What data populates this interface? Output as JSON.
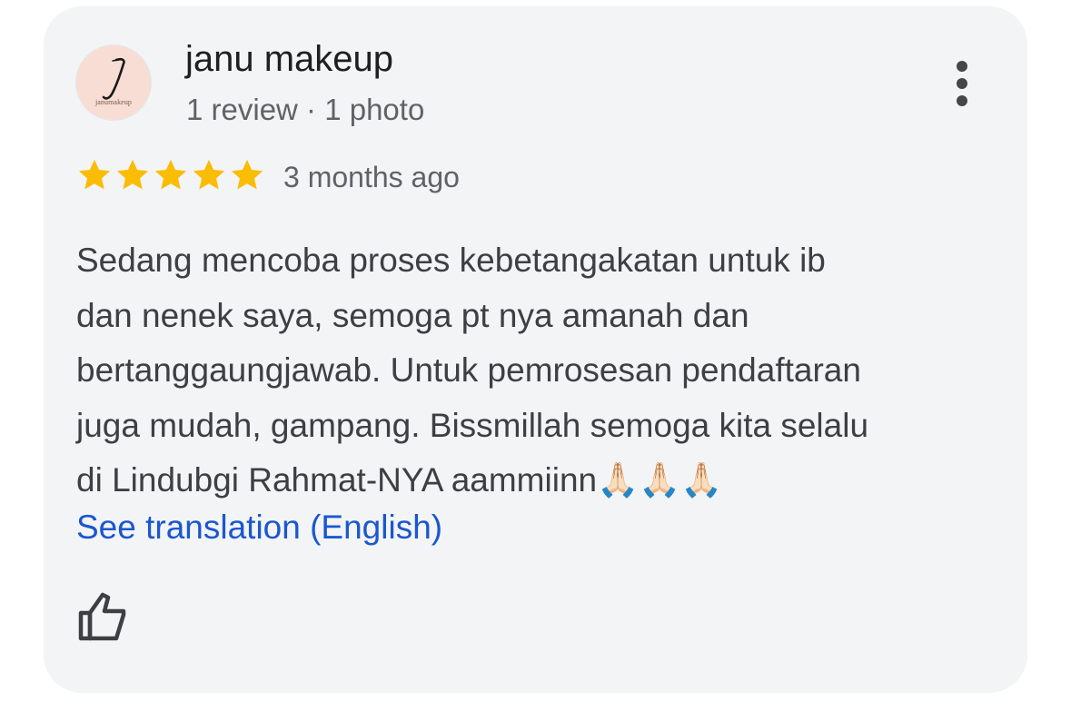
{
  "review": {
    "author": {
      "name": "janu makeup",
      "meta": "1 review · 1 photo",
      "avatar": {
        "monogram": "J",
        "wordmark": "janumakeup",
        "background_color": "#f7ddd3"
      }
    },
    "rating": {
      "stars": 5,
      "max": 5,
      "star_color": "#fbbc04"
    },
    "time_ago": "3 months ago",
    "text": "Sedang mencoba proses kebetangakatan untuk ib\ndan nenek saya, semoga pt nya amanah dan\nbertanggaungjawab. Untuk pemrosesan pendaftaran\njuga mudah, gampang. Bissmillah semoga kita selalu\ndi Lindubgi Rahmat-NYA aammiinn🙏🏻🙏🏻🙏🏻",
    "translate_link": "See translation (English)",
    "translate_link_color": "#1a57d0",
    "icons": {
      "menu": "more-vert-icon",
      "like": "thumb-up-icon",
      "star": "star-icon"
    }
  }
}
